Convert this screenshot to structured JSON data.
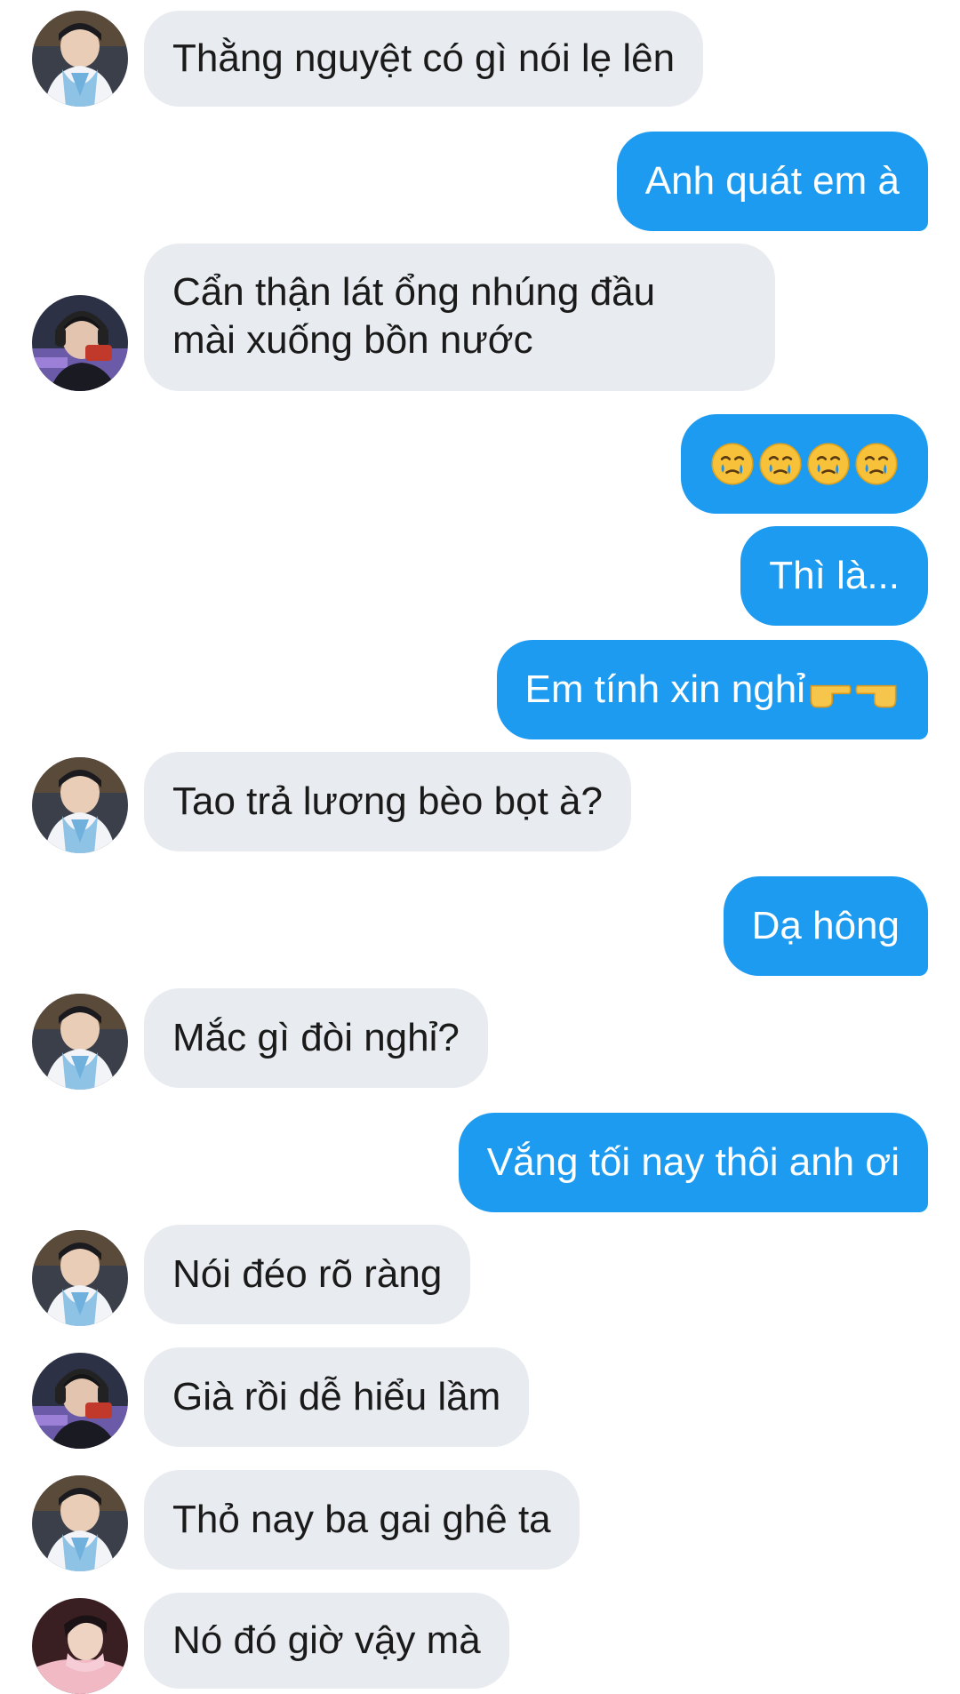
{
  "messages": [
    {
      "side": "in",
      "avatar": "avatar-blue-scarf",
      "text": "Thằng nguyệt có gì nói lẹ lên"
    },
    {
      "side": "out",
      "text": "Anh quát em à"
    },
    {
      "side": "in",
      "avatar": "avatar-headset",
      "lines": [
        "Cẩn thận lát ổng nhúng đầu",
        "mài xuống bồn nước"
      ]
    },
    {
      "side": "out",
      "emoji": [
        "face-holding-back-tears-icon",
        "face-holding-back-tears-icon",
        "face-holding-back-tears-icon",
        "face-holding-back-tears-icon"
      ]
    },
    {
      "side": "out",
      "text": "Thì là..."
    },
    {
      "side": "out",
      "text": "Em tính xin nghỉ",
      "trailing_emoji": [
        "backhand-index-pointing-right-icon",
        "backhand-index-pointing-left-icon"
      ]
    },
    {
      "side": "in",
      "avatar": "avatar-blue-scarf",
      "text": "Tao trả lương bèo bọt à?"
    },
    {
      "side": "out",
      "text": "Dạ hông"
    },
    {
      "side": "in",
      "avatar": "avatar-blue-scarf",
      "text": "Mắc gì đòi nghỉ?"
    },
    {
      "side": "out",
      "text": "Vắng tối nay thôi anh ơi"
    },
    {
      "side": "in",
      "avatar": "avatar-blue-scarf",
      "text": "Nói đéo rõ ràng"
    },
    {
      "side": "in",
      "avatar": "avatar-headset",
      "text": "Già rồi dễ hiểu lầm"
    },
    {
      "side": "in",
      "avatar": "avatar-blue-scarf",
      "text": "Thỏ nay ba gai ghê ta"
    },
    {
      "side": "in",
      "avatar": "avatar-pink-hood",
      "text": "Nó đó giờ vậy mà"
    }
  ],
  "colors": {
    "incoming_bubble": "#e8ebef",
    "outgoing_bubble": "#1d9bf0",
    "incoming_text": "#1a1a1a",
    "outgoing_text": "#ffffff",
    "background": "#ffffff"
  }
}
